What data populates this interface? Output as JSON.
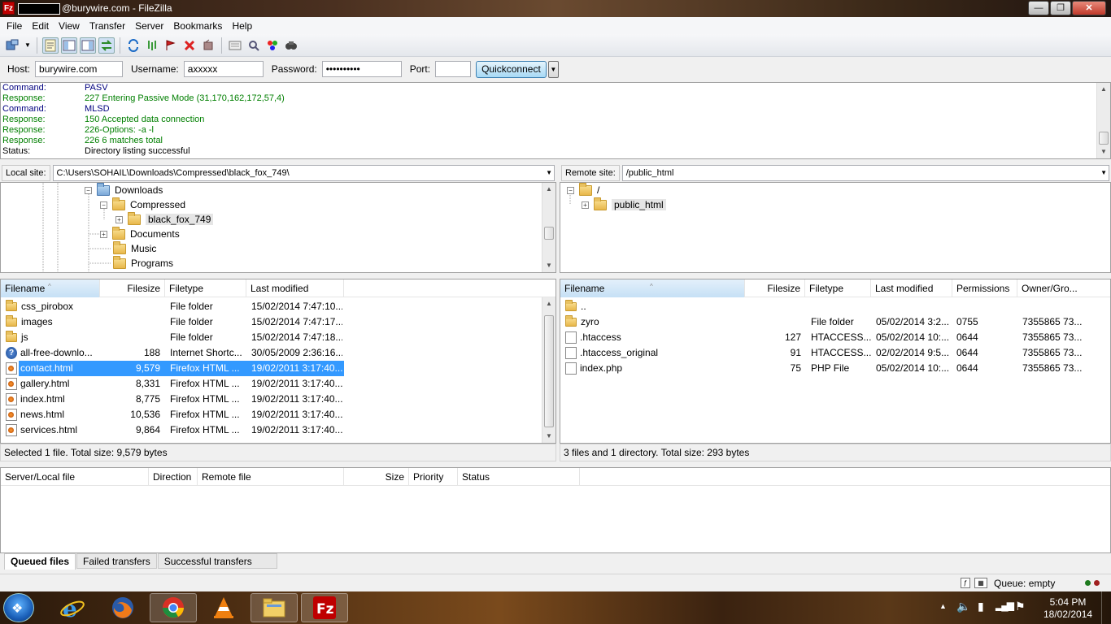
{
  "window": {
    "title": "@burywire.com - FileZilla",
    "app_icon": "Fz",
    "minimize": "—",
    "maximize": "❐",
    "close": "✕"
  },
  "menu": [
    "File",
    "Edit",
    "View",
    "Transfer",
    "Server",
    "Bookmarks",
    "Help"
  ],
  "toolbar": {
    "icons": [
      "site-manager-icon",
      "toggle-log-icon",
      "toggle-local-tree-icon",
      "toggle-remote-tree-icon",
      "toggle-queue-icon",
      "refresh-icon",
      "process-queue-icon",
      "cancel-icon",
      "disconnect-icon",
      "reconnect-icon",
      "directory-listing-filters-icon",
      "toggle-sync-browsing-icon",
      "directory-comparison-icon",
      "search-remote-files-icon"
    ]
  },
  "quickconnect": {
    "host_label": "Host:",
    "host_value": "burywire.com",
    "username_label": "Username:",
    "username_value": "axxxxx",
    "password_label": "Password:",
    "password_value": "••••••••••",
    "port_label": "Port:",
    "port_value": "",
    "button": "Quickconnect"
  },
  "log": [
    {
      "type": "command",
      "key": "Command:",
      "value": "PASV"
    },
    {
      "type": "response",
      "key": "Response:",
      "value": "227 Entering Passive Mode (31,170,162,172,57,4)"
    },
    {
      "type": "command",
      "key": "Command:",
      "value": "MLSD"
    },
    {
      "type": "response",
      "key": "Response:",
      "value": "150 Accepted data connection"
    },
    {
      "type": "response",
      "key": "Response:",
      "value": "226-Options: -a -l"
    },
    {
      "type": "response",
      "key": "Response:",
      "value": "226 6 matches total"
    },
    {
      "type": "status",
      "key": "Status:",
      "value": "Directory listing successful"
    }
  ],
  "local": {
    "site_label": "Local site:",
    "path": "C:\\Users\\SOHAIL\\Downloads\\Compressed\\black_fox_749\\",
    "tree": [
      {
        "label": "Downloads",
        "expander": "−",
        "icon": "blue"
      },
      {
        "label": "Compressed",
        "expander": "−",
        "icon": "yellow"
      },
      {
        "label": "black_fox_749",
        "expander": "+",
        "icon": "yellow"
      },
      {
        "label": "Documents",
        "expander": "+",
        "icon": "yellow"
      },
      {
        "label": "Music",
        "expander": "",
        "icon": "yellow"
      },
      {
        "label": "Programs",
        "expander": "",
        "icon": "yellow"
      }
    ],
    "headers": {
      "filename": "Filename",
      "filesize": "Filesize",
      "filetype": "Filetype",
      "modified": "Last modified"
    },
    "files": [
      {
        "name": "css_pirobox",
        "size": "",
        "type": "File folder",
        "modified": "15/02/2014 7:47:10...",
        "icon": "folder"
      },
      {
        "name": "images",
        "size": "",
        "type": "File folder",
        "modified": "15/02/2014 7:47:17...",
        "icon": "folder"
      },
      {
        "name": "js",
        "size": "",
        "type": "File folder",
        "modified": "15/02/2014 7:47:18...",
        "icon": "folder"
      },
      {
        "name": "all-free-downlo...",
        "size": "188",
        "type": "Internet Shortc...",
        "modified": "30/05/2009 2:36:16...",
        "icon": "url"
      },
      {
        "name": "contact.html",
        "size": "9,579",
        "type": "Firefox HTML ...",
        "modified": "19/02/2011 3:17:40...",
        "icon": "html",
        "selected": true
      },
      {
        "name": "gallery.html",
        "size": "8,331",
        "type": "Firefox HTML ...",
        "modified": "19/02/2011 3:17:40...",
        "icon": "html"
      },
      {
        "name": "index.html",
        "size": "8,775",
        "type": "Firefox HTML ...",
        "modified": "19/02/2011 3:17:40...",
        "icon": "html"
      },
      {
        "name": "news.html",
        "size": "10,536",
        "type": "Firefox HTML ...",
        "modified": "19/02/2011 3:17:40...",
        "icon": "html"
      },
      {
        "name": "services.html",
        "size": "9,864",
        "type": "Firefox HTML ...",
        "modified": "19/02/2011 3:17:40...",
        "icon": "html"
      }
    ],
    "status": "Selected 1 file. Total size: 9,579 bytes"
  },
  "remote": {
    "site_label": "Remote site:",
    "path": "/public_html",
    "tree": [
      {
        "label": "/",
        "expander": "−"
      },
      {
        "label": "public_html",
        "expander": "+"
      }
    ],
    "headers": {
      "filename": "Filename",
      "filesize": "Filesize",
      "filetype": "Filetype",
      "modified": "Last modified",
      "permissions": "Permissions",
      "owner": "Owner/Gro..."
    },
    "files": [
      {
        "name": "..",
        "size": "",
        "type": "",
        "modified": "",
        "perms": "",
        "owner": "",
        "icon": "folder"
      },
      {
        "name": "zyro",
        "size": "",
        "type": "File folder",
        "modified": "05/02/2014 3:2...",
        "perms": "0755",
        "owner": "7355865 73...",
        "icon": "folder"
      },
      {
        "name": ".htaccess",
        "size": "127",
        "type": "HTACCESS...",
        "modified": "05/02/2014 10:...",
        "perms": "0644",
        "owner": "7355865 73...",
        "icon": "doc"
      },
      {
        "name": ".htaccess_original",
        "size": "91",
        "type": "HTACCESS...",
        "modified": "02/02/2014 9:5...",
        "perms": "0644",
        "owner": "7355865 73...",
        "icon": "doc"
      },
      {
        "name": "index.php",
        "size": "75",
        "type": "PHP File",
        "modified": "05/02/2014 10:...",
        "perms": "0644",
        "owner": "7355865 73...",
        "icon": "doc"
      }
    ],
    "status": "3 files and 1 directory. Total size: 293 bytes"
  },
  "queue": {
    "headers": {
      "server_local": "Server/Local file",
      "direction": "Direction",
      "remote": "Remote file",
      "size": "Size",
      "priority": "Priority",
      "status": "Status"
    },
    "tabs": [
      "Queued files",
      "Failed transfers",
      "Successful transfers"
    ],
    "status": "Queue: empty"
  },
  "taskbar": {
    "apps": [
      "ie-icon",
      "firefox-icon",
      "chrome-icon",
      "vlc-icon",
      "explorer-icon",
      "filezilla-icon"
    ],
    "time": "5:04 PM",
    "date": "18/02/2014"
  }
}
